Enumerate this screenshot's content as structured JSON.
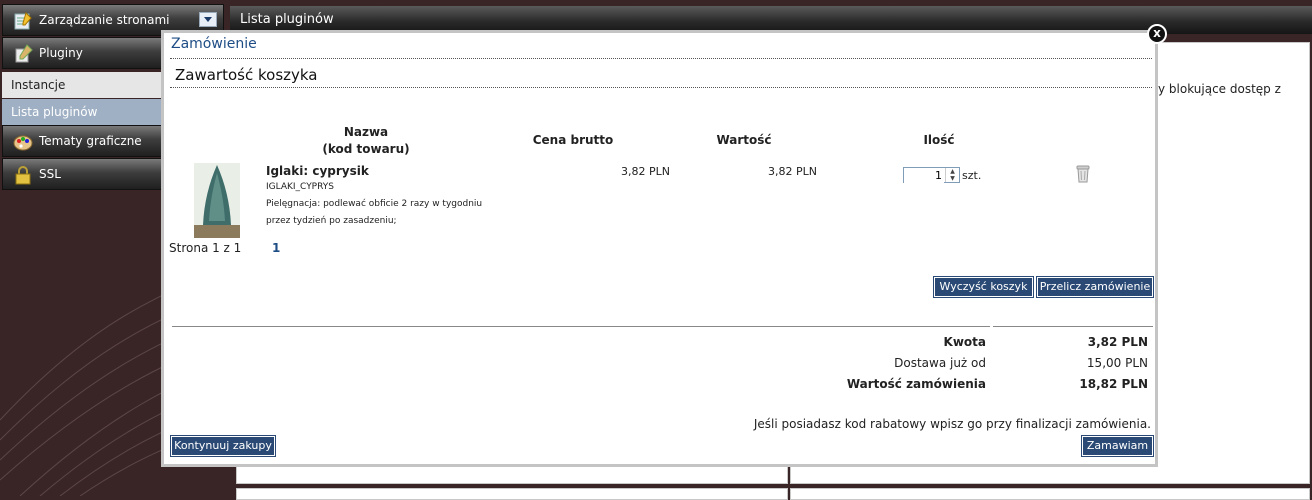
{
  "sidebar": {
    "pages_label": "Zarządzanie stronami",
    "plugins_label": "Pluginy",
    "sub_instances": "Instancje",
    "sub_plugin_list": "Lista pluginów",
    "themes_label": "Tematy graficzne",
    "ssl_label": "SSL"
  },
  "topbar": {
    "title": "Lista pluginów"
  },
  "background": {
    "partial_text": "y blokujące dostęp z"
  },
  "modal": {
    "title": "Zamówienie",
    "section_title": "Zawartość koszyka",
    "close_label": "x",
    "columns": {
      "name": "Nazwa",
      "code": "(kod towaru)",
      "price": "Cena brutto",
      "value": "Wartość",
      "qty": "Ilość"
    },
    "item": {
      "name": "Iglaki: cyprysik",
      "code": "IGLAKI_CYPRYS",
      "note_line1": "Pielęgnacja: podlewać obficie 2 razy w tygodniu",
      "note_line2": "przez tydzień po zasadzeniu;",
      "price": "3,82 PLN",
      "value": "3,82 PLN",
      "quantity": "1",
      "unit": "szt."
    },
    "pagination": {
      "text": "Strona 1 z 1",
      "current": "1"
    },
    "buttons": {
      "clear_cart": "Wyczyść koszyk",
      "recalculate": "Przelicz zamówienie",
      "continue": "Kontynuuj zakupy",
      "order": "Zamawiam"
    },
    "summary": {
      "amount_label": "Kwota",
      "amount_value": "3,82 PLN",
      "delivery_label": "Dostawa już od",
      "delivery_value": "15,00 PLN",
      "total_label": "Wartość zamówienia",
      "total_value": "18,82 PLN"
    },
    "discount_note": "Jeśli posiadasz kod rabatowy wpisz go przy finalizacji zamówienia."
  },
  "colors": {
    "background": "#3a2526",
    "accent": "#2a4a75",
    "title": "#1e4d86"
  }
}
